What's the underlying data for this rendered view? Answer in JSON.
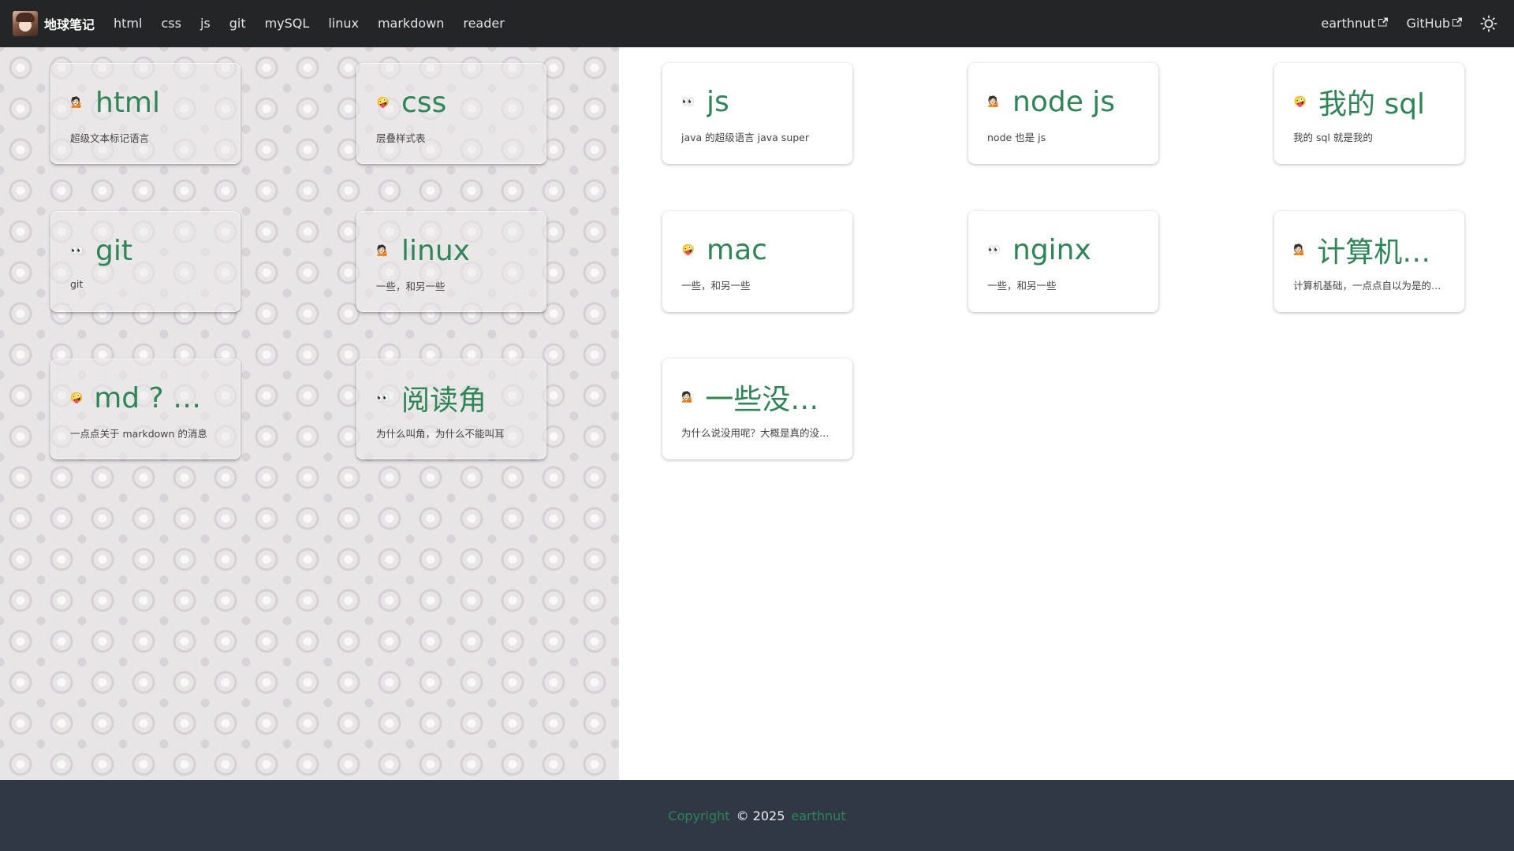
{
  "navbar": {
    "brand_title": "地球笔记",
    "links": [
      "html",
      "css",
      "js",
      "git",
      "mySQL",
      "linux",
      "markdown",
      "reader"
    ],
    "right_links": [
      "earthnut",
      "GitHub"
    ]
  },
  "cards": [
    {
      "emoji": "💁🏻",
      "title": "html",
      "desc": "超级文本标记语言"
    },
    {
      "emoji": "🤪",
      "title": "css",
      "desc": "层叠样式表"
    },
    {
      "emoji": "👀",
      "title": "js",
      "desc": "java 的超级语言 java super"
    },
    {
      "emoji": "💁🏻",
      "title": "node js",
      "desc": "node 也是 js"
    },
    {
      "emoji": "🤪",
      "title": "我的 sql",
      "desc": "我的 sql 就是我的"
    },
    {
      "emoji": "👀",
      "title": "git",
      "desc": "git"
    },
    {
      "emoji": "💁🏻",
      "title": "linux",
      "desc": "一些，和另一些"
    },
    {
      "emoji": "🤪",
      "title": "mac",
      "desc": "一些，和另一些"
    },
    {
      "emoji": "👀",
      "title": "nginx",
      "desc": "一些，和另一些"
    },
    {
      "emoji": "💁🏻",
      "title": "计算机基础",
      "desc": "计算机基础，一点点自以为是的东西"
    },
    {
      "emoji": "🤪",
      "title": "md ? markdown",
      "desc": "一点点关于 markdown 的消息"
    },
    {
      "emoji": "👀",
      "title": "阅读角",
      "desc": "为什么叫角，为什么不能叫耳"
    },
    {
      "emoji": "💁🏻",
      "title": "一些没用的东西",
      "desc": "为什么说没用呢？大概是真的没用吧"
    }
  ],
  "footer": {
    "copyright_label": "Copyright",
    "year_text": "© 2025",
    "author": "earthnut"
  }
}
